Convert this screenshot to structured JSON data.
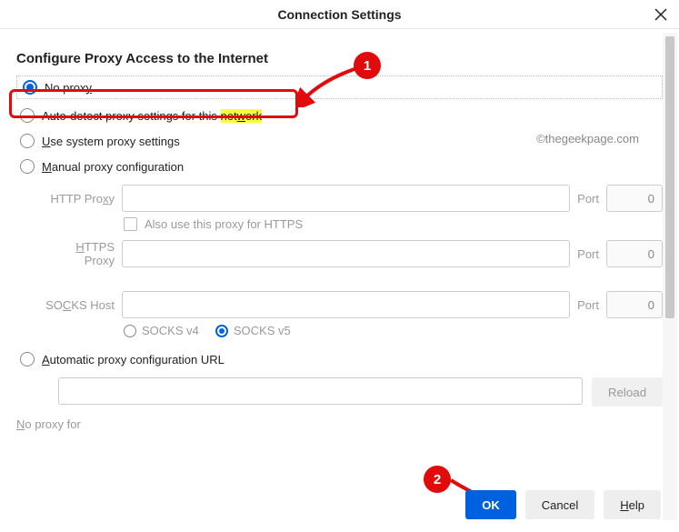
{
  "header": {
    "title": "Connection Settings"
  },
  "section_title": "Configure Proxy Access to the Internet",
  "watermark": "©thegeekpage.com",
  "options": {
    "no_proxy": {
      "pre": "No prox",
      "key": "y"
    },
    "auto_detect": {
      "pre": "Auto-detect proxy settings for this ",
      "hl_pre": "net",
      "hl_key": "w",
      "hl_post": "ork"
    },
    "system": {
      "key": "U",
      "post": "se system proxy settings"
    },
    "manual": {
      "key": "M",
      "post": "anual proxy configuration"
    }
  },
  "fields": {
    "http_label": {
      "pre": "HTTP Pro",
      "key": "x",
      "post": "y"
    },
    "port_label": {
      "key": "P",
      "post": "ort"
    },
    "port_value": "0",
    "also_https": {
      "key": "A",
      "post": "lso use this proxy for HTTPS"
    },
    "https_label": {
      "key": "H",
      "post": "TTPS Proxy"
    },
    "https_port_label": {
      "pre": "P",
      "key": "o",
      "post": "rt"
    },
    "socks_label": {
      "pre": "SO",
      "key": "C",
      "post": "KS Host"
    },
    "socks_port_label": {
      "pre": "Por",
      "key": "t"
    },
    "socks_v4": {
      "pre": "SOC",
      "key": "K",
      "post": "S v4"
    },
    "socks_v5": {
      "pre": "SOCKS ",
      "key": "v",
      "post": "5"
    }
  },
  "auto_url": {
    "key": "A",
    "post": "utomatic proxy configuration URL"
  },
  "reload_label": "Reload",
  "no_proxy_for": {
    "key": "N",
    "post": "o proxy for"
  },
  "footer": {
    "ok": "OK",
    "cancel": "Cancel",
    "help": {
      "key": "H",
      "post": "elp"
    }
  },
  "annotations": {
    "badge1": "1",
    "badge2": "2"
  }
}
